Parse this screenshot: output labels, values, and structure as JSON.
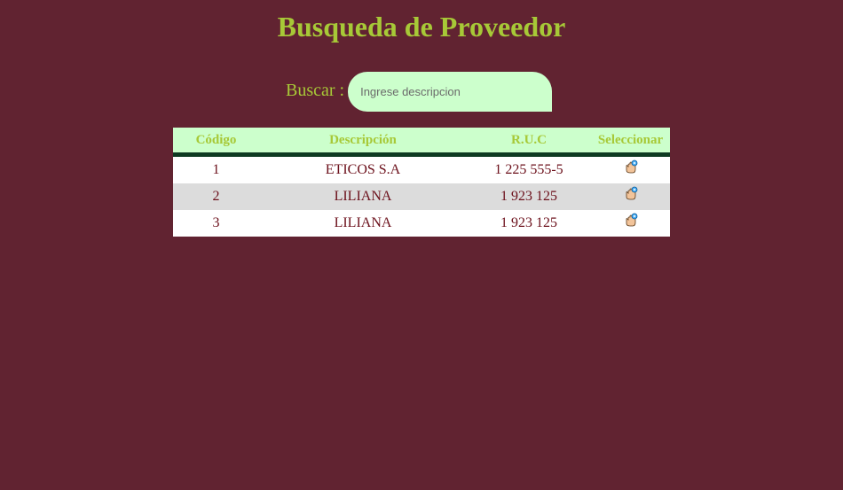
{
  "page": {
    "title": "Busqueda de Proveedor"
  },
  "search": {
    "label": "Buscar :",
    "placeholder": "Ingrese descripcion",
    "value": ""
  },
  "table": {
    "headers": {
      "code": "Código",
      "description": "Descripción",
      "ruc": "R.U.C",
      "select": "Seleccionar"
    },
    "rows": [
      {
        "code": "1",
        "description": "ETICOS S.A",
        "ruc": "1 225 555-5",
        "select_icon": "hand-pointer-select-icon"
      },
      {
        "code": "2",
        "description": "LILIANA",
        "ruc": "1 923 125",
        "select_icon": "hand-pointer-select-icon"
      },
      {
        "code": "3",
        "description": "LILIANA",
        "ruc": "1 923 125",
        "select_icon": "hand-pointer-select-icon"
      }
    ]
  },
  "colors": {
    "background": "#612331",
    "accent_text": "#a7c937",
    "header_bg": "#ccffcc",
    "header_border": "#0e3a22",
    "cell_text": "#6b0f1a",
    "row_alt_bg": "#dcdcdc"
  }
}
